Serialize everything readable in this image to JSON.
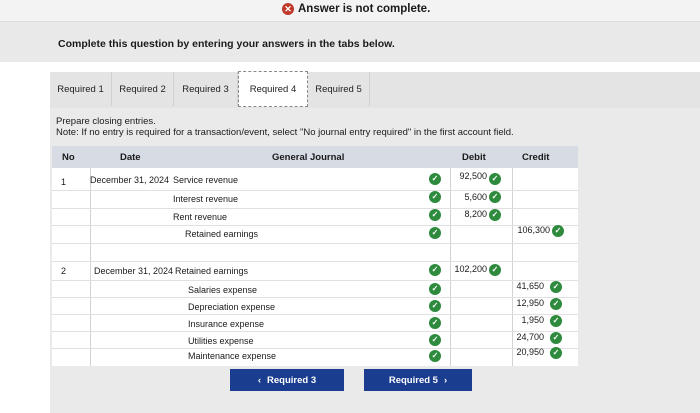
{
  "banner": {
    "text": "Answer is not complete."
  },
  "instruction": "Complete this question by entering your answers in the tabs below.",
  "tabs": [
    {
      "label": "Required 1"
    },
    {
      "label": "Required 2"
    },
    {
      "label": "Required 3"
    },
    {
      "label": "Required 4"
    },
    {
      "label": "Required 5"
    }
  ],
  "prompt": {
    "line1": "Prepare closing entries.",
    "line2": "Note: If no entry is required for a transaction/event, select \"No journal entry required\" in the first account field."
  },
  "table": {
    "headers": {
      "no": "No",
      "date": "Date",
      "journal": "General Journal",
      "debit": "Debit",
      "credit": "Credit"
    },
    "entries": [
      {
        "no": "1",
        "date": "December 31, 2024",
        "lines": [
          {
            "account": "Service revenue",
            "debit": "92,500",
            "credit": ""
          },
          {
            "account": "Interest revenue",
            "debit": "5,600",
            "credit": ""
          },
          {
            "account": "Rent revenue",
            "debit": "8,200",
            "credit": ""
          },
          {
            "account": "Retained earnings",
            "debit": "",
            "credit": "106,300"
          }
        ]
      },
      {
        "no": "2",
        "date": "December 31, 2024",
        "lines": [
          {
            "account": "Retained earnings",
            "debit": "102,200",
            "credit": ""
          },
          {
            "account": "Salaries expense",
            "debit": "",
            "credit": "41,650"
          },
          {
            "account": "Depreciation expense",
            "debit": "",
            "credit": "12,950"
          },
          {
            "account": "Insurance expense",
            "debit": "",
            "credit": "1,950"
          },
          {
            "account": "Utilities expense",
            "debit": "",
            "credit": "24,700"
          },
          {
            "account": "Maintenance expense",
            "debit": "",
            "credit": "20,950"
          }
        ]
      }
    ]
  },
  "nav": {
    "prev_label": "Required 3",
    "next_label": "Required 5"
  },
  "colors": {
    "accent": "#1a3d8f",
    "check": "#2e8b3e",
    "error": "#c0392b"
  }
}
